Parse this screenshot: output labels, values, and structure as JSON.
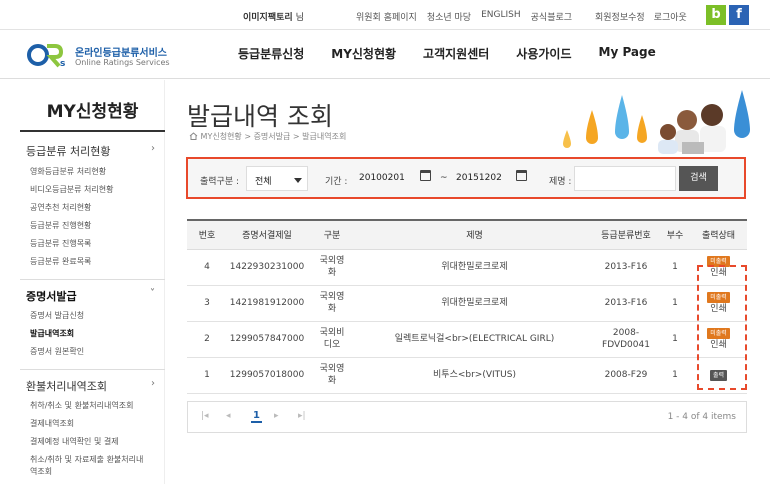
{
  "topbar": {
    "user_name": "이미지팩토리",
    "user_suffix": "님",
    "links": [
      "위원회 홈페이지",
      "청소년 마당",
      "ENGLISH",
      "공식블로그"
    ],
    "account_links": [
      "회원정보수정",
      "로그아웃"
    ],
    "sns": [
      "b",
      "f"
    ]
  },
  "header": {
    "logo_title": "온라인등급분류서비스",
    "logo_sub": "Online Ratings Services",
    "nav": [
      "등급분류신청",
      "MY신청현황",
      "고객지원센터",
      "사용가이드",
      "My Page"
    ]
  },
  "sidebar": {
    "title": "MY신청현황",
    "groups": [
      {
        "label": "등급분류 처리현황",
        "chevron": "›",
        "items": [
          "영화등급분류 처리현황",
          "비디오등급분류 처리현황",
          "공연추천 처리현황",
          "등급분류 진행현황",
          "등급분류 진행목록",
          "등급분류 완료목록"
        ]
      },
      {
        "label": "증명서발급",
        "chevron": "˅",
        "items": [
          "증명서 발급신청",
          "발급내역조회",
          "증명서 원본확인"
        ]
      },
      {
        "label": "환불처리내역조회",
        "chevron": "›",
        "items": [
          "취하/취소 및 환불처리내역조회",
          "결제내역조회",
          "결제예정 내역확인 및 결제",
          "취소/취하 및 자료제출 환불처리내",
          "역조회"
        ]
      }
    ]
  },
  "page": {
    "title": "발급내역 조회",
    "breadcrumb": "MY신청현황 > 증명서발급 > 발급내역조회"
  },
  "search": {
    "type_label": "출력구분 :",
    "type_value": "전체",
    "period_label": "기간 :",
    "date_from": "20100201",
    "tilde": "~",
    "date_to": "20151202",
    "title_label": "제명 :",
    "title_placeholder": "",
    "button": "검색"
  },
  "table": {
    "headers": [
      "번호",
      "증명서결제일",
      "구분",
      "제명",
      "등급분류번호",
      "부수",
      "출력상태"
    ],
    "rows": [
      {
        "no": "4",
        "date": "1422930231000",
        "type1": "국외영",
        "type2": "화",
        "title": "위대한밀로크로제",
        "rating1": "2013-F16",
        "rating2": "",
        "count": "1",
        "badge": "미출력",
        "badge_color": "#e0781e",
        "status": "인쇄"
      },
      {
        "no": "3",
        "date": "1421981912000",
        "type1": "국외영",
        "type2": "화",
        "title": "위대한밀로크로제",
        "rating1": "2013-F16",
        "rating2": "",
        "count": "1",
        "badge": "미출력",
        "badge_color": "#e0781e",
        "status": "인쇄"
      },
      {
        "no": "2",
        "date": "1299057847000",
        "type1": "국외비",
        "type2": "디오",
        "title": "일렉트로닉걸<br>(ELECTRICAL GIRL)",
        "rating1": "2008-",
        "rating2": "FDVD0041",
        "count": "1",
        "badge": "미출력",
        "badge_color": "#e0781e",
        "status": "인쇄"
      },
      {
        "no": "1",
        "date": "1299057018000",
        "type1": "국외영",
        "type2": "화",
        "title": "비투스<br>(VITUS)",
        "rating1": "2008-F29",
        "rating2": "",
        "count": "1",
        "badge": "출력",
        "badge_color": "#555555",
        "status": ""
      }
    ]
  },
  "pager": {
    "first": "|◂",
    "prev": "◂",
    "current": "1",
    "next": "▸",
    "last": "▸|",
    "info": "1 - 4 of 4 items"
  }
}
